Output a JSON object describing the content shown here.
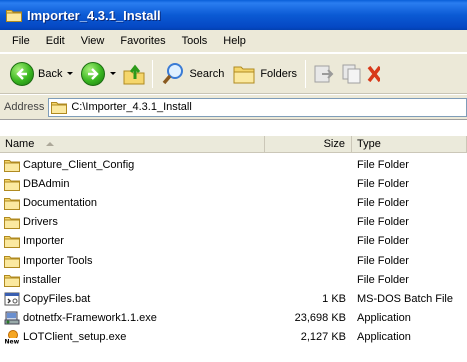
{
  "window": {
    "title": "Importer_4.3.1_Install"
  },
  "menu": [
    "File",
    "Edit",
    "View",
    "Favorites",
    "Tools",
    "Help"
  ],
  "toolbar": {
    "back_label": "Back",
    "search_label": "Search",
    "folders_label": "Folders"
  },
  "address": {
    "label": "Address",
    "path": "C:\\Importer_4.3.1_Install"
  },
  "columns": {
    "name": "Name",
    "size": "Size",
    "type": "Type"
  },
  "files": [
    {
      "name": "Capture_Client_Config",
      "size": "",
      "type": "File Folder",
      "icon": "folder-icon"
    },
    {
      "name": "DBAdmin",
      "size": "",
      "type": "File Folder",
      "icon": "folder-icon"
    },
    {
      "name": "Documentation",
      "size": "",
      "type": "File Folder",
      "icon": "folder-icon"
    },
    {
      "name": "Drivers",
      "size": "",
      "type": "File Folder",
      "icon": "folder-icon"
    },
    {
      "name": "Importer",
      "size": "",
      "type": "File Folder",
      "icon": "folder-icon"
    },
    {
      "name": "Importer Tools",
      "size": "",
      "type": "File Folder",
      "icon": "folder-icon"
    },
    {
      "name": "installer",
      "size": "",
      "type": "File Folder",
      "icon": "folder-icon"
    },
    {
      "name": "CopyFiles.bat",
      "size": "1 KB",
      "type": "MS-DOS Batch File",
      "icon": "batch-file-icon"
    },
    {
      "name": "dotnetfx-Framework1.1.exe",
      "size": "23,698 KB",
      "type": "Application",
      "icon": "installer-exe-icon"
    },
    {
      "name": "LOTClient_setup.exe",
      "size": "2,127 KB",
      "type": "Application",
      "icon": "new-setup-exe-icon"
    }
  ],
  "colors": {
    "titlebar": "#0b5ad4",
    "chrome": "#ece9d8",
    "folder": "#f5d66b"
  }
}
